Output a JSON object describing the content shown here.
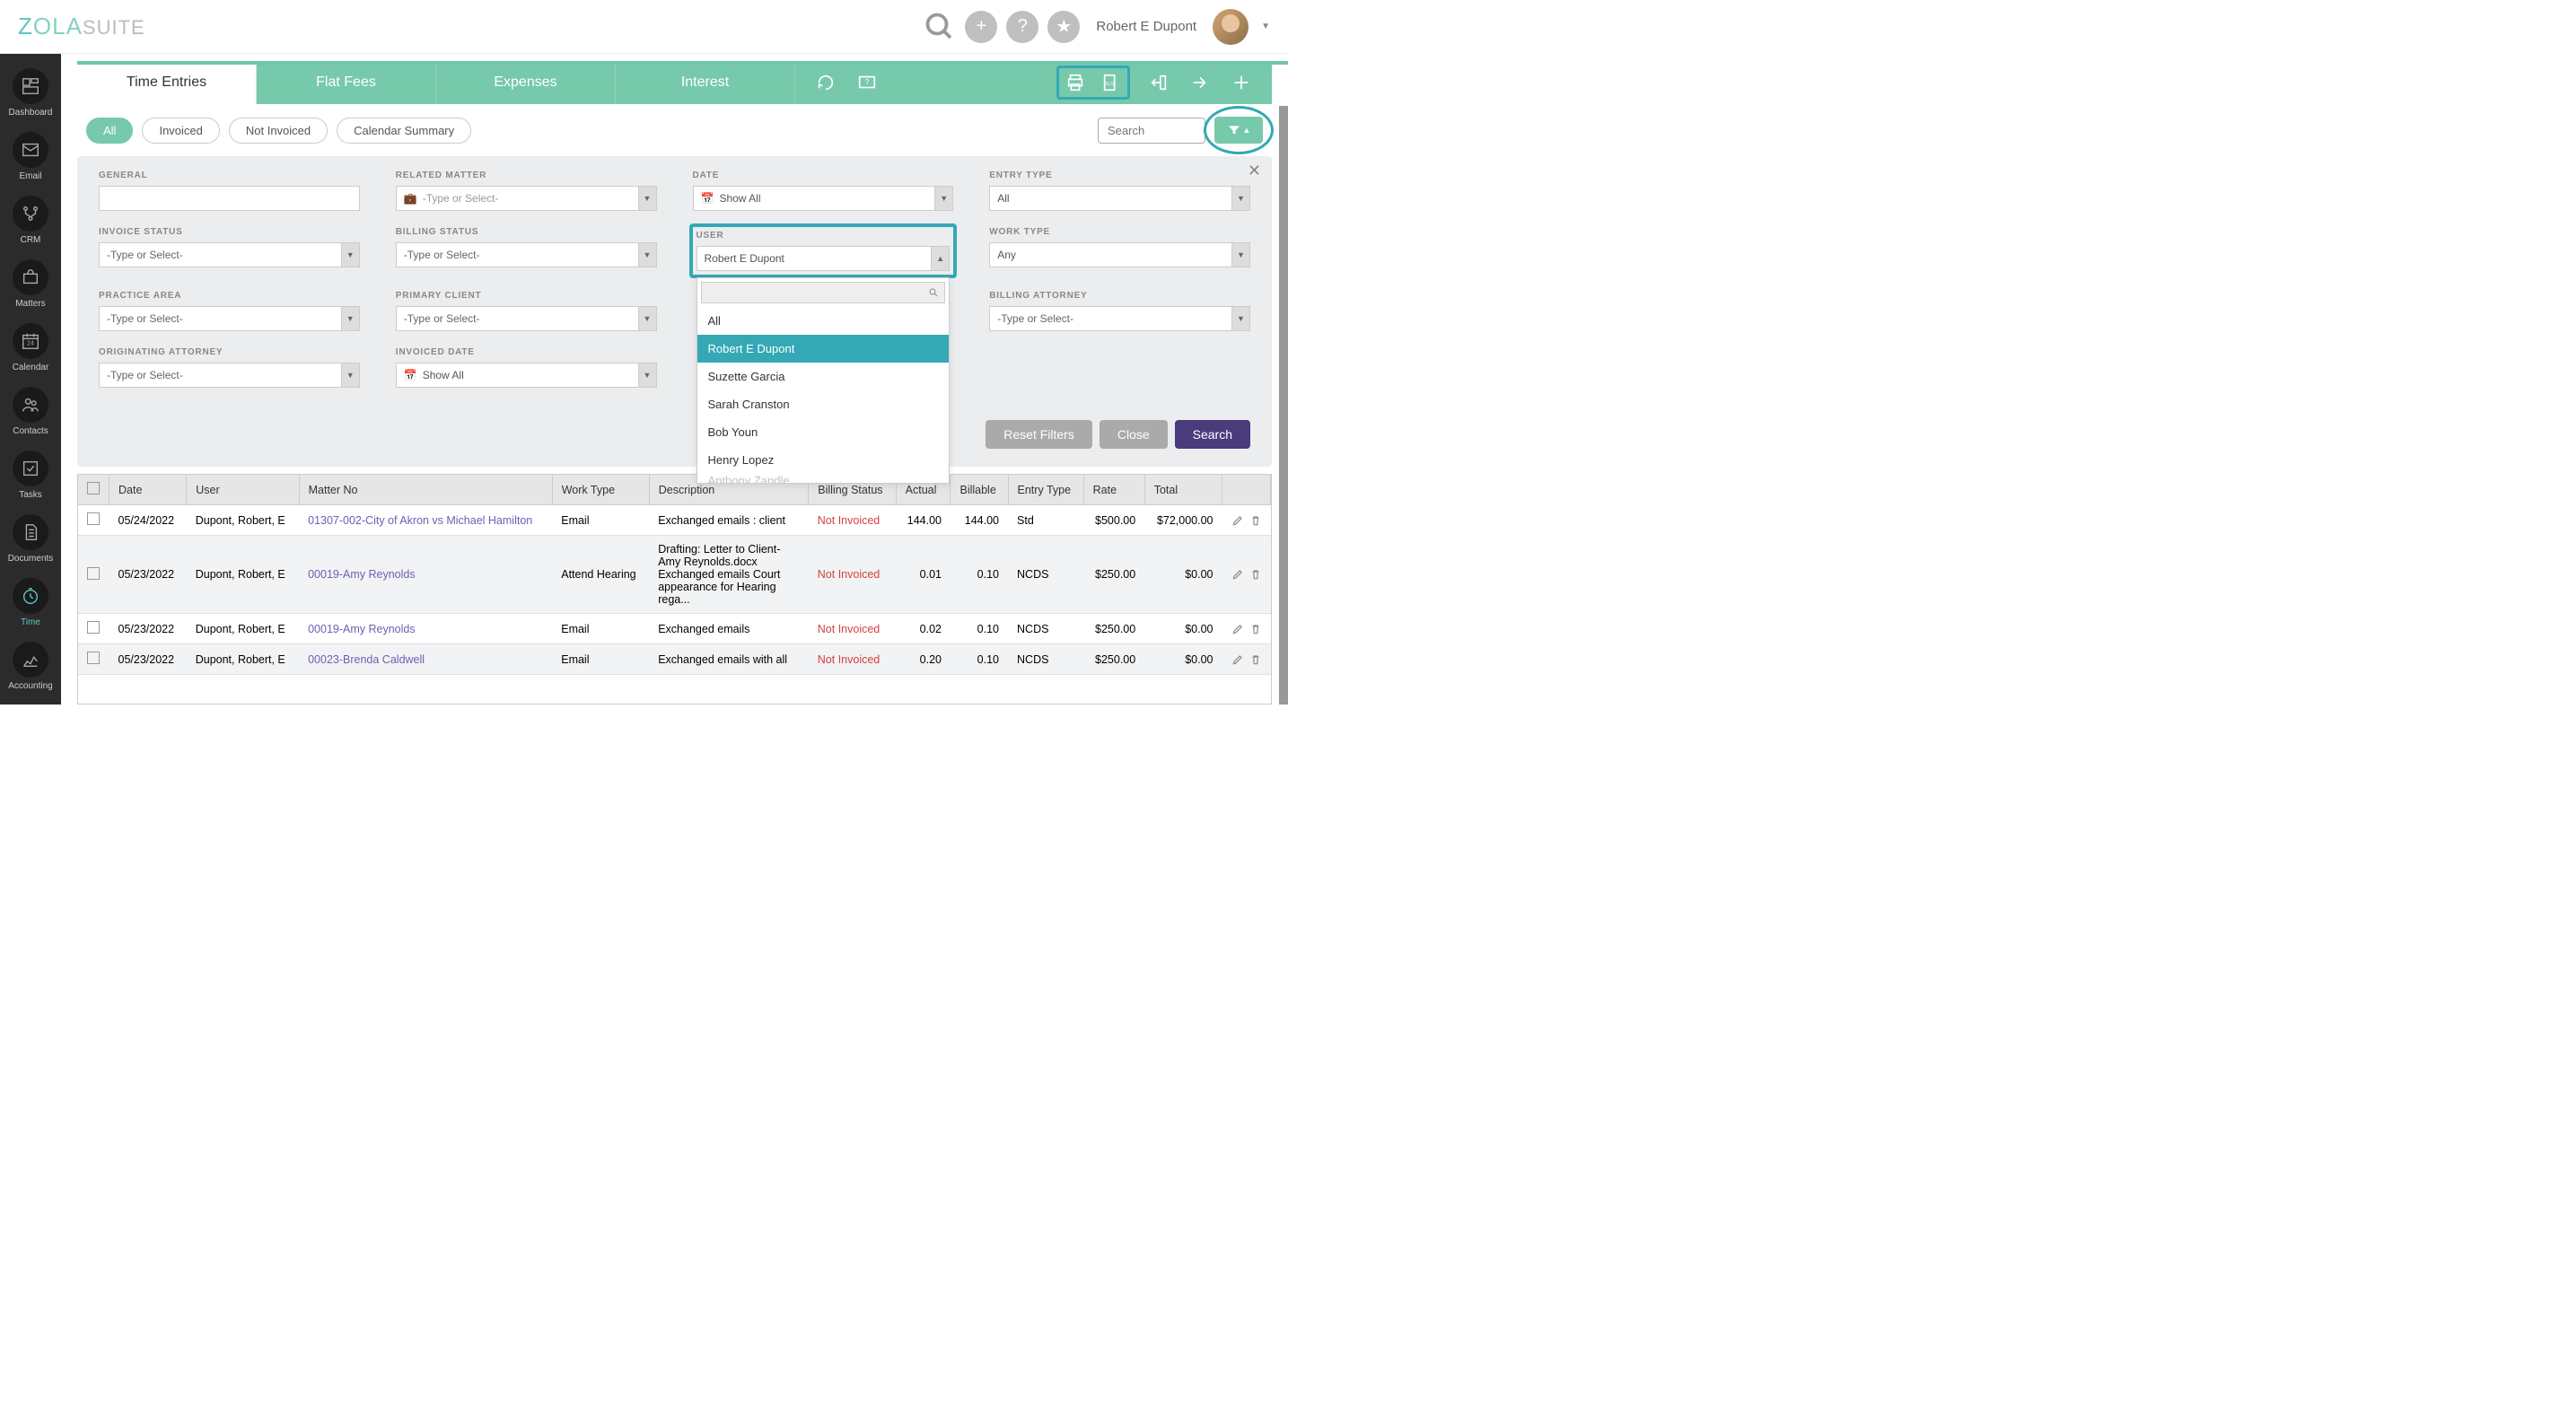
{
  "brand": {
    "z": "Z",
    "ola": "OLA",
    "suite": "SUITE"
  },
  "topbar": {
    "username": "Robert E Dupont"
  },
  "sidebar": {
    "items": [
      {
        "label": "Dashboard"
      },
      {
        "label": "Email"
      },
      {
        "label": "CRM"
      },
      {
        "label": "Matters"
      },
      {
        "label": "Calendar",
        "badge": "24"
      },
      {
        "label": "Contacts"
      },
      {
        "label": "Tasks"
      },
      {
        "label": "Documents"
      },
      {
        "label": "Time"
      },
      {
        "label": "Accounting"
      }
    ]
  },
  "tabs": {
    "time_entries": "Time Entries",
    "flat_fees": "Flat Fees",
    "expenses": "Expenses",
    "interest": "Interest"
  },
  "pills": {
    "all": "All",
    "invoiced": "Invoiced",
    "not_invoiced": "Not Invoiced",
    "calendar_summary": "Calendar Summary"
  },
  "search_placeholder": "Search",
  "filters": {
    "general": {
      "label": "General"
    },
    "related_matter": {
      "label": "Related Matter",
      "placeholder": "-Type or Select-"
    },
    "date": {
      "label": "Date",
      "value": "Show All"
    },
    "entry_type": {
      "label": "Entry Type",
      "value": "All"
    },
    "invoice_status": {
      "label": "Invoice Status",
      "placeholder": "-Type or Select-"
    },
    "billing_status": {
      "label": "Billing Status",
      "placeholder": "-Type or Select-"
    },
    "user": {
      "label": "User",
      "value": "Robert E Dupont",
      "options": [
        "All",
        "Robert E Dupont",
        "Suzette Garcia",
        "Sarah Cranston",
        "Bob Youn",
        "Henry Lopez",
        "Anthony Zandle"
      ]
    },
    "work_type": {
      "label": "Work Type",
      "value": "Any"
    },
    "practice_area": {
      "label": "Practice Area",
      "placeholder": "-Type or Select-"
    },
    "primary_client": {
      "label": "Primary Client",
      "placeholder": "-Type or Select-"
    },
    "billing_attorney": {
      "label": "Billing Attorney",
      "placeholder": "-Type or Select-"
    },
    "originating_attorney": {
      "label": "Originating Attorney",
      "placeholder": "-Type or Select-"
    },
    "invoiced_date": {
      "label": "Invoiced Date",
      "value": "Show All"
    },
    "buttons": {
      "reset": "Reset Filters",
      "close": "Close",
      "search": "Search"
    }
  },
  "table": {
    "headers": {
      "date": "Date",
      "user": "User",
      "matter": "Matter No",
      "work": "Work Type",
      "desc": "Description",
      "billing": "Billing Status",
      "actual": "Actual",
      "billable": "Billable",
      "entry": "Entry Type",
      "rate": "Rate",
      "total": "Total"
    },
    "rows": [
      {
        "date": "05/24/2022",
        "user": "Dupont, Robert, E",
        "matter": "01307-002-City of Akron vs Michael Hamilton",
        "work": "Email",
        "desc": "Exchanged emails : client",
        "billing": "Not Invoiced",
        "actual": "144.00",
        "billable": "144.00",
        "entry": "Std",
        "rate": "$500.00",
        "total": "$72,000.00"
      },
      {
        "date": "05/23/2022",
        "user": "Dupont, Robert, E",
        "matter": "00019-Amy Reynolds",
        "work": "Attend Hearing",
        "desc": "Drafting: Letter to Client-Amy Reynolds.docx Exchanged emails Court appearance for Hearing rega...",
        "billing": "Not Invoiced",
        "actual": "0.01",
        "billable": "0.10",
        "entry": "NCDS",
        "rate": "$250.00",
        "total": "$0.00"
      },
      {
        "date": "05/23/2022",
        "user": "Dupont, Robert, E",
        "matter": "00019-Amy Reynolds",
        "work": "Email",
        "desc": "Exchanged emails",
        "billing": "Not Invoiced",
        "actual": "0.02",
        "billable": "0.10",
        "entry": "NCDS",
        "rate": "$250.00",
        "total": "$0.00"
      },
      {
        "date": "05/23/2022",
        "user": "Dupont, Robert, E",
        "matter": "00023-Brenda Caldwell",
        "work": "Email",
        "desc": "Exchanged emails with all",
        "billing": "Not Invoiced",
        "actual": "0.20",
        "billable": "0.10",
        "entry": "NCDS",
        "rate": "$250.00",
        "total": "$0.00"
      }
    ]
  }
}
